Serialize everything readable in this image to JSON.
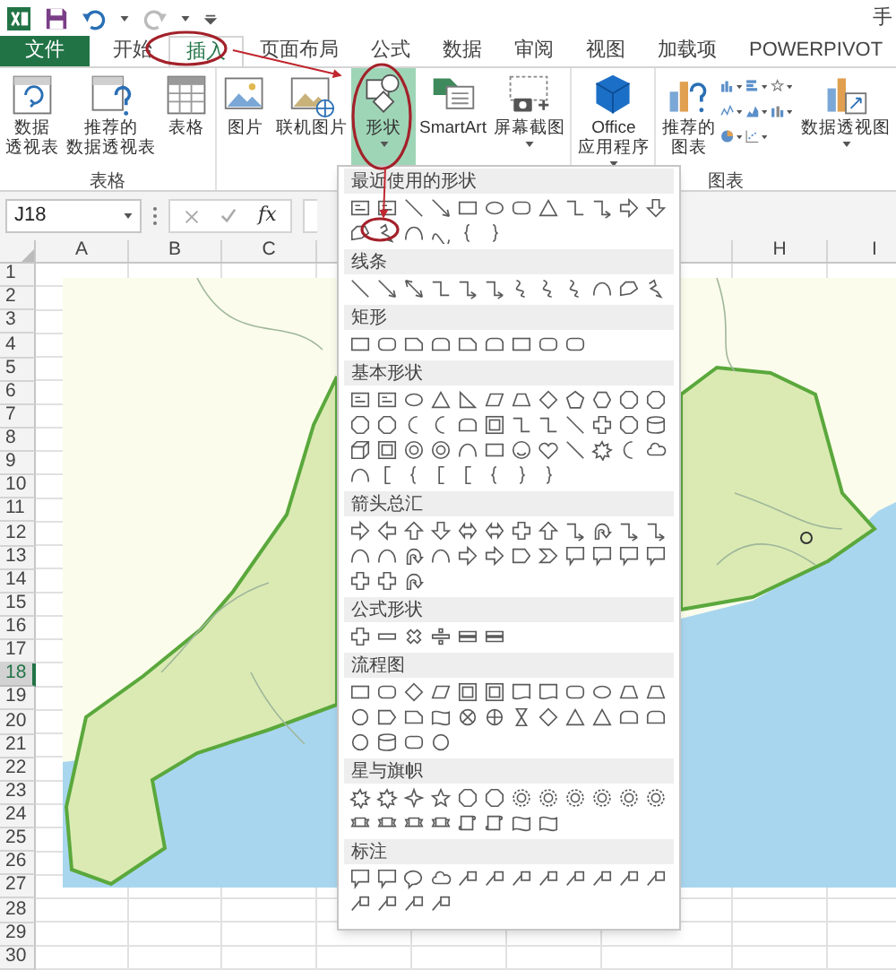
{
  "title_bar": {
    "title": "手"
  },
  "tabs": [
    {
      "label": "文件",
      "kind": "file",
      "selected": false
    },
    {
      "label": "开始",
      "kind": "tab",
      "selected": false
    },
    {
      "label": "插入",
      "kind": "tab",
      "selected": true
    },
    {
      "label": "页面布局",
      "kind": "tab",
      "selected": false
    },
    {
      "label": "公式",
      "kind": "tab",
      "selected": false
    },
    {
      "label": "数据",
      "kind": "tab",
      "selected": false
    },
    {
      "label": "审阅",
      "kind": "tab",
      "selected": false
    },
    {
      "label": "视图",
      "kind": "tab",
      "selected": false
    },
    {
      "label": "加载项",
      "kind": "tab",
      "selected": false
    },
    {
      "label": "POWERPIVOT",
      "kind": "tab",
      "selected": false
    }
  ],
  "ribbon": {
    "groups": [
      {
        "label": "表格",
        "buttons": [
          {
            "lines": [
              "数据",
              "透视表"
            ],
            "menu": false,
            "expanded": false
          },
          {
            "lines": [
              "推荐的",
              "数据透视表"
            ],
            "menu": false,
            "expanded": false
          },
          {
            "lines": [
              "表格"
            ],
            "menu": false,
            "expanded": false
          }
        ]
      },
      {
        "buttons": [
          {
            "lines": [
              "图片"
            ],
            "menu": false,
            "expanded": false
          },
          {
            "lines": [
              "联机图片"
            ],
            "menu": false,
            "expanded": false
          },
          {
            "lines": [
              "形状"
            ],
            "menu": true,
            "expanded": true
          },
          {
            "lines": [
              "SmartArt"
            ],
            "menu": false,
            "expanded": false
          },
          {
            "lines": [
              "屏幕截图"
            ],
            "menu": true,
            "expanded": false
          }
        ]
      },
      {
        "buttons": [
          {
            "lines": [
              "Office",
              "应用程序"
            ],
            "menu": true,
            "expanded": false
          }
        ]
      },
      {
        "label": "图表",
        "buttons": [
          {
            "lines": [
              "推荐的",
              "图表"
            ],
            "menu": false,
            "expanded": false
          }
        ]
      },
      {
        "buttons": [
          {
            "lines": [
              "数据透视图"
            ],
            "menu": true,
            "expanded": false
          }
        ]
      }
    ]
  },
  "formula_bar": {
    "name_box": "J18",
    "function_button": "fx"
  },
  "columns": [
    {
      "label": "A"
    },
    {
      "label": "B"
    },
    {
      "label": "C"
    },
    {
      "label": "H"
    },
    {
      "label": "I"
    }
  ],
  "rows": [
    {
      "label": "1",
      "selected": false
    },
    {
      "label": "2",
      "selected": false
    },
    {
      "label": "3",
      "selected": false
    },
    {
      "label": "4",
      "selected": false
    },
    {
      "label": "5",
      "selected": false
    },
    {
      "label": "6",
      "selected": false
    },
    {
      "label": "7",
      "selected": false
    },
    {
      "label": "8",
      "selected": false
    },
    {
      "label": "9",
      "selected": false
    },
    {
      "label": "10",
      "selected": false
    },
    {
      "label": "11",
      "selected": false
    },
    {
      "label": "12",
      "selected": false
    },
    {
      "label": "13",
      "selected": false
    },
    {
      "label": "14",
      "selected": false
    },
    {
      "label": "15",
      "selected": false
    },
    {
      "label": "16",
      "selected": false
    },
    {
      "label": "17",
      "selected": false
    },
    {
      "label": "18",
      "selected": true
    },
    {
      "label": "19",
      "selected": false
    },
    {
      "label": "20",
      "selected": false
    },
    {
      "label": "21",
      "selected": false
    },
    {
      "label": "22",
      "selected": false
    },
    {
      "label": "23",
      "selected": false
    },
    {
      "label": "24",
      "selected": false
    },
    {
      "label": "25",
      "selected": false
    },
    {
      "label": "26",
      "selected": false
    },
    {
      "label": "27",
      "selected": false
    },
    {
      "label": "28",
      "selected": false
    },
    {
      "label": "29",
      "selected": false
    },
    {
      "label": "30",
      "selected": false
    }
  ],
  "shapes_menu": {
    "sections": [
      {
        "title": "最近使用的形状"
      },
      {
        "title": "线条"
      },
      {
        "title": "矩形"
      },
      {
        "title": "基本形状"
      },
      {
        "title": "箭头总汇"
      },
      {
        "title": "公式形状"
      },
      {
        "title": "流程图"
      },
      {
        "title": "星与旗帜"
      },
      {
        "title": "标注"
      }
    ]
  }
}
